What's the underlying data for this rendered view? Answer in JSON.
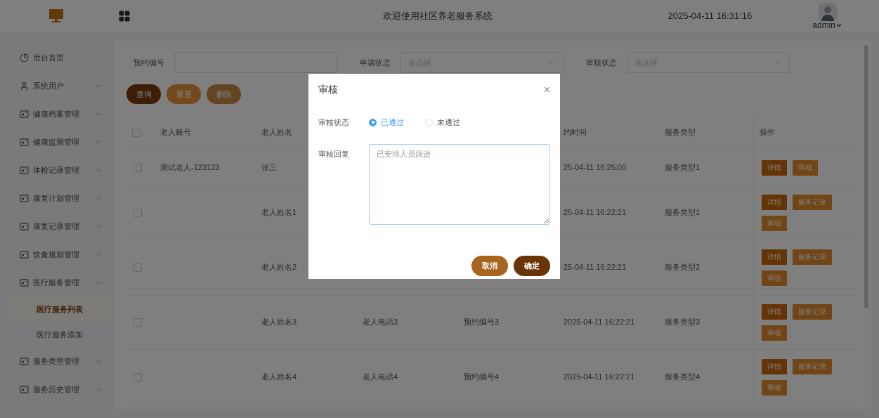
{
  "header": {
    "title": "欢迎使用社区养老服务系统",
    "datetime": "2025-04-11 16:31:16",
    "user": "admin"
  },
  "sidebar": {
    "items": [
      {
        "label": "后台首页",
        "kind": "home"
      },
      {
        "label": "系统用户",
        "kind": "user",
        "expanded": false
      },
      {
        "label": "健康档案管理",
        "kind": "module",
        "expanded": false
      },
      {
        "label": "健康监测管理",
        "kind": "module",
        "expanded": false
      },
      {
        "label": "体检记录管理",
        "kind": "module",
        "expanded": false
      },
      {
        "label": "康复计划管理",
        "kind": "module",
        "expanded": false
      },
      {
        "label": "康复记录管理",
        "kind": "module",
        "expanded": false
      },
      {
        "label": "饮食规划管理",
        "kind": "module",
        "expanded": false
      },
      {
        "label": "医疗服务管理",
        "kind": "module",
        "expanded": true,
        "children": [
          {
            "label": "医疗服务列表",
            "selected": true
          },
          {
            "label": "医疗服务添加",
            "selected": false
          }
        ]
      },
      {
        "label": "服务类型管理",
        "kind": "module",
        "expanded": false
      },
      {
        "label": "服务历史管理",
        "kind": "module",
        "expanded": false
      }
    ]
  },
  "filters": [
    {
      "label": "预约编号",
      "kind": "text"
    },
    {
      "label": "申请状态",
      "kind": "select",
      "placeholder": "请选择"
    },
    {
      "label": "审核状态",
      "kind": "select",
      "placeholder": "请选择"
    }
  ],
  "toolbar": [
    {
      "label": "查询",
      "kind": "primary",
      "disabled": false
    },
    {
      "label": "重置",
      "kind": "secondary",
      "disabled": false
    },
    {
      "label": "删除",
      "kind": "danger",
      "disabled": true
    }
  ],
  "table": {
    "select_all_checked": false,
    "columns": {
      "account": "老人账号",
      "name": "老人姓名",
      "time": "约时间",
      "service_type": "服务类型",
      "actions": "操作"
    },
    "rows": [
      {
        "checked": false,
        "account": "测试老人-123123",
        "name": "张三",
        "time": "25-04-11 16:25:00",
        "service_type": "服务类型1",
        "actions": [
          {
            "label": "详情",
            "kind": "detail"
          },
          {
            "label": "审核",
            "kind": "other"
          }
        ]
      },
      {
        "checked": false,
        "name": "老人姓名1",
        "time": "25-04-11 16:22:21",
        "service_type": "服务类型1",
        "actions": [
          {
            "label": "详情",
            "kind": "detail"
          },
          {
            "label": "服务记录",
            "kind": "other"
          },
          {
            "label": "审核",
            "kind": "other"
          }
        ]
      },
      {
        "checked": false,
        "name": "老人姓名2",
        "time": "25-04-11 16:22:21",
        "service_type": "服务类型2",
        "actions": [
          {
            "label": "详情",
            "kind": "detail"
          },
          {
            "label": "服务记录",
            "kind": "other"
          },
          {
            "label": "审核",
            "kind": "other"
          }
        ]
      },
      {
        "checked": false,
        "name": "老人姓名3",
        "phone": "老人电话3",
        "booking_no": "预约编号3",
        "time": "2025-04-11 16:22:21",
        "service_type": "服务类型3",
        "actions": [
          {
            "label": "详情",
            "kind": "detail"
          },
          {
            "label": "服务记录",
            "kind": "other"
          },
          {
            "label": "审核",
            "kind": "other"
          }
        ]
      },
      {
        "checked": false,
        "name": "老人姓名4",
        "phone": "老人电话4",
        "booking_no": "预约编号4",
        "time": "2025-04-11 16:22:21",
        "service_type": "服务类型4",
        "actions": [
          {
            "label": "详情",
            "kind": "detail"
          },
          {
            "label": "服务记录",
            "kind": "other"
          },
          {
            "label": "审核",
            "kind": "other"
          }
        ]
      }
    ]
  },
  "dialog": {
    "title": "审核",
    "close": "×",
    "status_label": "审核状态",
    "options": [
      {
        "label": "已通过",
        "selected": true
      },
      {
        "label": "未通过",
        "selected": false
      }
    ],
    "reply_label": "审核回复",
    "reply_placeholder": "已安排人员跟进",
    "buttons": [
      {
        "label": "取消",
        "kind": "cancel"
      },
      {
        "label": "确定",
        "kind": "confirm"
      }
    ]
  }
}
